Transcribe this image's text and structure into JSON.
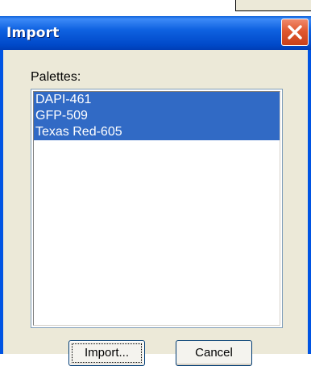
{
  "dialog": {
    "title": "Import",
    "close_icon": "close-x-icon"
  },
  "palettes": {
    "label": "Palettes:",
    "items": [
      "DAPI-461",
      "GFP-509",
      "Texas Red-605"
    ],
    "selected": [
      "DAPI-461",
      "GFP-509",
      "Texas Red-605"
    ]
  },
  "buttons": {
    "import_label": "Import...",
    "cancel_label": "Cancel"
  },
  "colors": {
    "titlebar": "#0054e3",
    "selection": "#316ac5",
    "close_button": "#e0582f",
    "dialog_face": "#ece9d8"
  }
}
